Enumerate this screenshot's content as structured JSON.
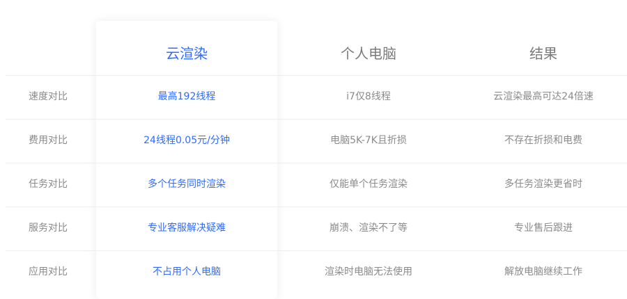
{
  "colors": {
    "accent": "#2f6bff",
    "muted_text": "#8a8a8a",
    "divider": "#eeeeee"
  },
  "header": {
    "cloud": "云渲染",
    "pc": "个人电脑",
    "result": "结果"
  },
  "rows": [
    {
      "label": "速度对比",
      "cloud": "最高192线程",
      "pc": "i7仅8线程",
      "result": "云渲染最高可达24倍速"
    },
    {
      "label": "费用对比",
      "cloud": "24线程0.05元/分钟",
      "pc": "电脑5K-7K且折损",
      "result": "不存在折损和电费"
    },
    {
      "label": "任务对比",
      "cloud": "多个任务同时渲染",
      "pc": "仅能单个任务渲染",
      "result": "多任务渲染更省时"
    },
    {
      "label": "服务对比",
      "cloud": "专业客服解决疑难",
      "pc": "崩溃、渲染不了等",
      "result": "专业售后跟进"
    },
    {
      "label": "应用对比",
      "cloud": "不占用个人电脑",
      "pc": "渲染时电脑无法使用",
      "result": "解放电脑继续工作"
    }
  ]
}
